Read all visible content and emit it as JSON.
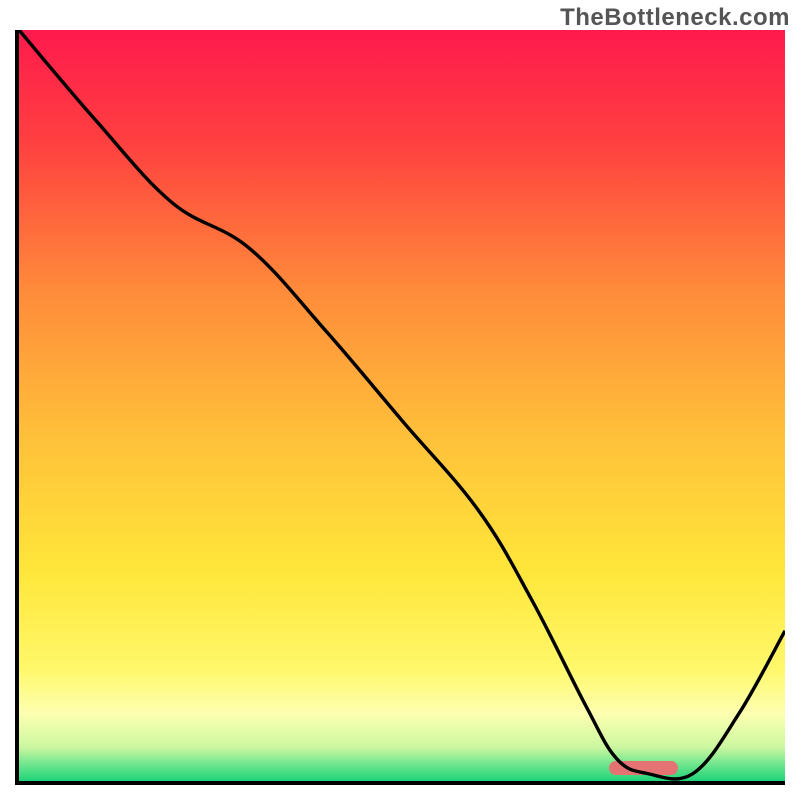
{
  "watermark": "TheBottleneck.com",
  "chart_data": {
    "type": "line",
    "title": "",
    "xlabel": "",
    "ylabel": "",
    "xlim": [
      0,
      100
    ],
    "ylim": [
      0,
      100
    ],
    "series": [
      {
        "name": "curve",
        "color": "#000000",
        "x": [
          0,
          10,
          20,
          30,
          40,
          50,
          60,
          67,
          74,
          78,
          82,
          88,
          94,
          100
        ],
        "y": [
          100,
          88,
          77,
          71,
          60,
          48,
          36,
          24,
          10,
          3,
          1,
          1,
          9,
          20
        ]
      }
    ],
    "annotations": [
      {
        "name": "optimum-marker",
        "shape": "rounded-bar",
        "color": "#e57373",
        "x_start": 77,
        "x_end": 86,
        "y": 0.5
      }
    ],
    "background_gradient": {
      "type": "vertical",
      "stops": [
        {
          "pos": 0.0,
          "color": "#ff1a4d"
        },
        {
          "pos": 0.15,
          "color": "#ff4040"
        },
        {
          "pos": 0.35,
          "color": "#ff8c3a"
        },
        {
          "pos": 0.55,
          "color": "#ffc23a"
        },
        {
          "pos": 0.72,
          "color": "#ffe63a"
        },
        {
          "pos": 0.85,
          "color": "#fff86a"
        },
        {
          "pos": 0.91,
          "color": "#fdffb0"
        },
        {
          "pos": 0.955,
          "color": "#ccf7a0"
        },
        {
          "pos": 0.975,
          "color": "#7ae890"
        },
        {
          "pos": 1.0,
          "color": "#1ed47a"
        }
      ]
    }
  }
}
